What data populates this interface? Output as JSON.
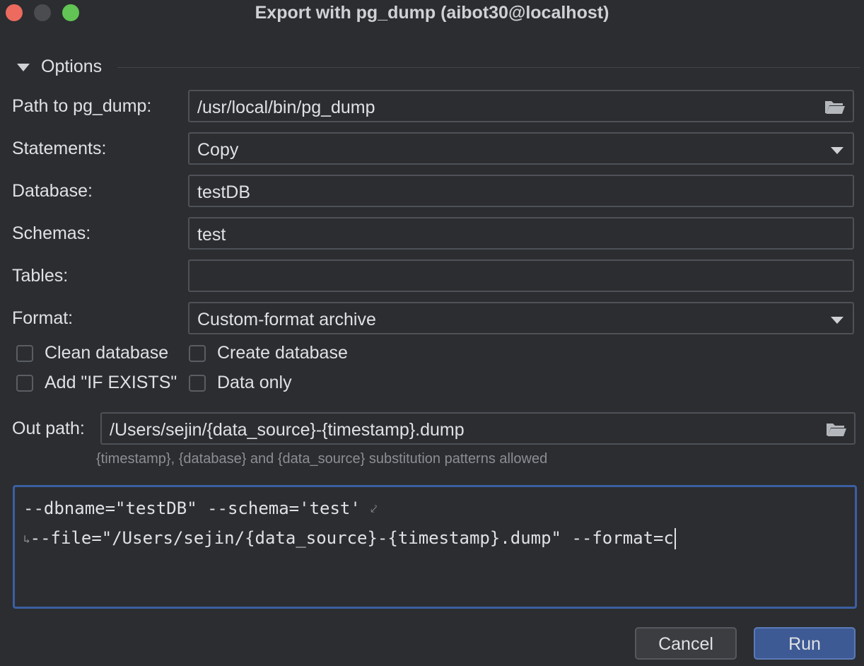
{
  "window": {
    "title": "Export with pg_dump (aibot30@localhost)"
  },
  "options": {
    "section_title": "Options",
    "path_label": "Path to pg_dump:",
    "path_value": "/usr/local/bin/pg_dump",
    "statements_label": "Statements:",
    "statements_value": "Copy",
    "database_label": "Database:",
    "database_value": "testDB",
    "schemas_label": "Schemas:",
    "schemas_value": "test",
    "tables_label": "Tables:",
    "tables_value": "",
    "format_label": "Format:",
    "format_value": "Custom-format archive"
  },
  "checkboxes": {
    "clean_database": {
      "label": "Clean database",
      "checked": false
    },
    "create_database": {
      "label": "Create database",
      "checked": false
    },
    "add_if_exists": {
      "label": "Add \"IF EXISTS\"",
      "checked": false
    },
    "data_only": {
      "label": "Data only",
      "checked": false
    }
  },
  "out": {
    "label": "Out path:",
    "value": "/Users/sejin/{data_source}-{timestamp}.dump",
    "hint": "{timestamp}, {database} and {data_source} substitution patterns allowed"
  },
  "command": {
    "line1": "--dbname=\"testDB\" --schema='test' ",
    "line2": "--file=\"/Users/sejin/{data_source}-{timestamp}.dump\" --format=c"
  },
  "buttons": {
    "cancel": "Cancel",
    "run": "Run"
  },
  "icons": {
    "folder": "folder-icon",
    "dropdown": "chevron-down-icon",
    "collapse": "triangle-down-icon",
    "wrap": "soft-wrap-icon"
  },
  "colors": {
    "background": "#2b2d30",
    "accent": "#3e5a94",
    "focus_border": "#3c5fa3",
    "close": "#ec6a5e",
    "maximize": "#61c454"
  }
}
